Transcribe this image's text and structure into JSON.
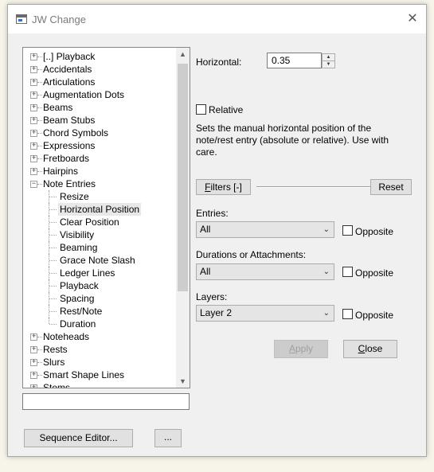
{
  "window": {
    "title": "JW Change",
    "close_glyph": "✕"
  },
  "tree": {
    "top_items": [
      {
        "label": "[..] Playback"
      },
      {
        "label": "Accidentals"
      },
      {
        "label": "Articulations"
      },
      {
        "label": "Augmentation Dots"
      },
      {
        "label": "Beams"
      },
      {
        "label": "Beam Stubs"
      },
      {
        "label": "Chord Symbols"
      },
      {
        "label": "Expressions"
      },
      {
        "label": "Fretboards"
      },
      {
        "label": "Hairpins"
      },
      {
        "label": "Note Entries",
        "expanded": true
      }
    ],
    "children": [
      {
        "label": "Resize"
      },
      {
        "label": "Horizontal Position",
        "selected": true
      },
      {
        "label": "Clear Position"
      },
      {
        "label": "Visibility"
      },
      {
        "label": "Beaming"
      },
      {
        "label": "Grace Note Slash"
      },
      {
        "label": "Ledger Lines"
      },
      {
        "label": "Playback"
      },
      {
        "label": "Spacing"
      },
      {
        "label": "Rest/Note"
      },
      {
        "label": "Duration"
      }
    ],
    "bottom_items": [
      {
        "label": "Noteheads"
      },
      {
        "label": "Rests"
      },
      {
        "label": "Slurs"
      },
      {
        "label": "Smart Shape Lines"
      },
      {
        "label": "Stems"
      }
    ],
    "expand_glyph": "+",
    "collapse_glyph": "−"
  },
  "find": {
    "value": ""
  },
  "buttons": {
    "sequence_editor": "Sequence Editor...",
    "more": "...",
    "filters_prefix": "F",
    "filters_rest": "ilters [-]",
    "reset": "Reset",
    "apply_prefix": "A",
    "apply_rest": "pply",
    "close_prefix": "C",
    "close_rest": "lose"
  },
  "horizontal": {
    "label": "Horizontal:",
    "value": "0.35",
    "spin_up": "▲",
    "spin_down": "▼"
  },
  "relative": {
    "label": "Relative",
    "checked": false
  },
  "description": "Sets the manual horizontal position of the note/rest entry (absolute or relative). Use with care.",
  "entries": {
    "label": "Entries:",
    "value": "All",
    "opposite_label": "Opposite"
  },
  "durations": {
    "label": "Durations or Attachments:",
    "value": "All",
    "opposite_label": "Opposite"
  },
  "layers": {
    "label": "Layers:",
    "value": "Layer 2",
    "opposite_label": "Opposite"
  },
  "scroll": {
    "up": "▲",
    "down": "▼"
  },
  "combo_chevron": "⌄"
}
